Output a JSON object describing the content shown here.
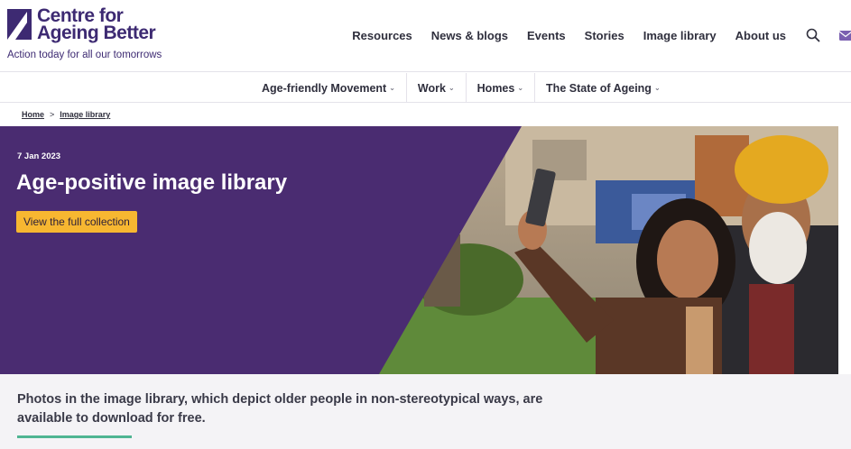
{
  "brand": {
    "name_line1": "Centre for",
    "name_line2": "Ageing Better",
    "tagline": "Action today for all our tomorrows",
    "color": "#3d2a72"
  },
  "top_nav": {
    "items": [
      {
        "label": "Resources"
      },
      {
        "label": "News & blogs"
      },
      {
        "label": "Events"
      },
      {
        "label": "Stories"
      },
      {
        "label": "Image library"
      },
      {
        "label": "About us"
      }
    ],
    "search_icon": "search-icon",
    "mail_icon": "mail-icon"
  },
  "sub_nav": {
    "items": [
      {
        "label": "Age-friendly Movement"
      },
      {
        "label": "Work"
      },
      {
        "label": "Homes"
      },
      {
        "label": "The State of Ageing"
      }
    ],
    "dropdown_icon": "chevron-down-icon"
  },
  "breadcrumb": {
    "home": "Home",
    "separator": ">",
    "current": "Image library"
  },
  "hero": {
    "date": "7 Jan 2023",
    "title": "Age-positive image library",
    "cta_label": "View the full collection",
    "background_color": "#4a2c71",
    "cta_color": "#f7b731"
  },
  "intro": {
    "text": "Photos in the image library, which depict older people in non-stereotypical ways, are available to download for free.",
    "accent_color": "#4fb592"
  }
}
